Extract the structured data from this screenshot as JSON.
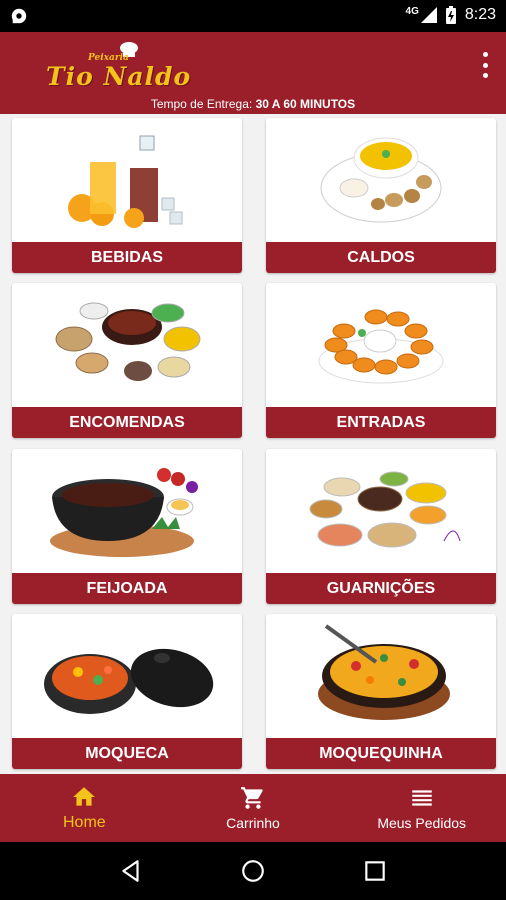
{
  "status_bar": {
    "time": "8:23",
    "network": "4G"
  },
  "app": {
    "logo_top": "Peixaria",
    "logo_main": "Tio Naldo",
    "delivery_prefix": "Tempo de Entrega: ",
    "delivery_value": "30 A 60 MINUTOS"
  },
  "categories": [
    {
      "label": "BEBIDAS"
    },
    {
      "label": "CALDOS"
    },
    {
      "label": "ENCOMENDAS"
    },
    {
      "label": "ENTRADAS"
    },
    {
      "label": "FEIJOADA"
    },
    {
      "label": "GUARNIÇÕES"
    },
    {
      "label": "MOQUECA"
    },
    {
      "label": "MOQUEQUINHA"
    }
  ],
  "bottom_nav": [
    {
      "label": "Home",
      "icon": "home-icon",
      "active": true
    },
    {
      "label": "Carrinho",
      "icon": "cart-icon",
      "active": false
    },
    {
      "label": "Meus Pedidos",
      "icon": "list-icon",
      "active": false
    }
  ],
  "colors": {
    "brand": "#9a1f2b",
    "accent": "#f3c21b"
  }
}
